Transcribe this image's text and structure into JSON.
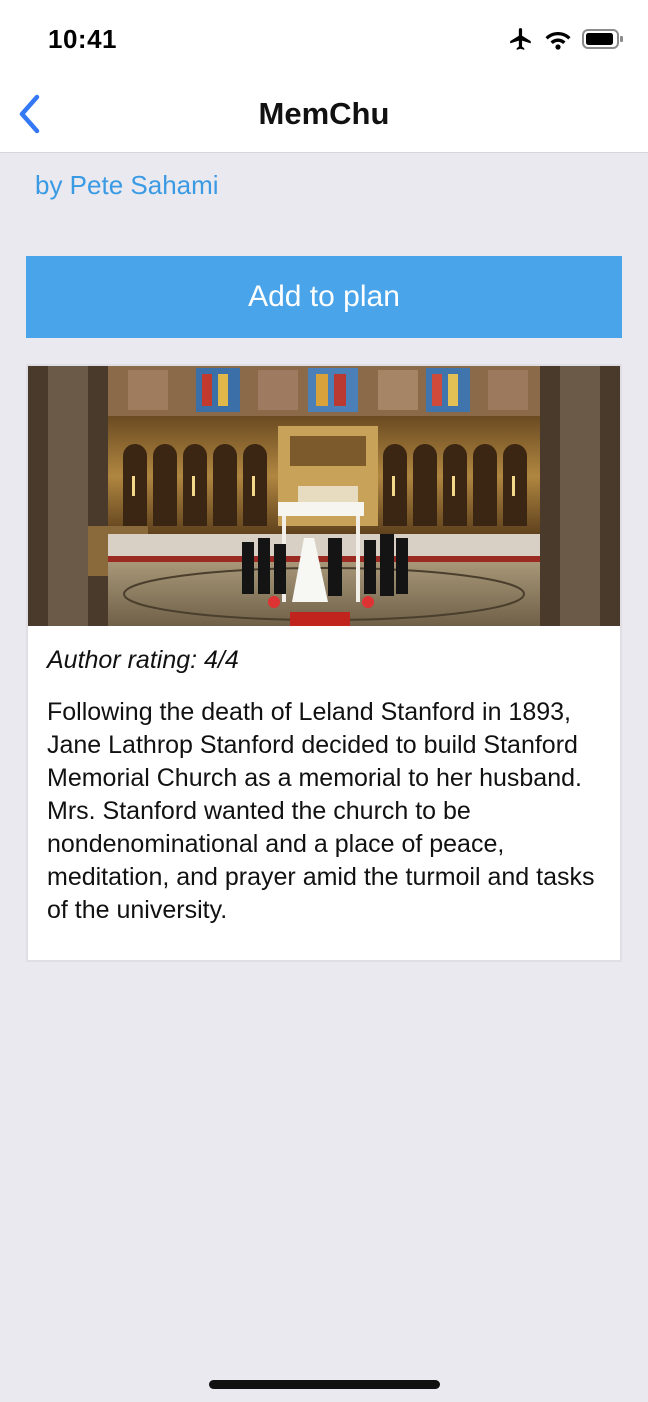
{
  "status_bar": {
    "time": "10:41",
    "icons": [
      "airplane-icon",
      "wifi-icon",
      "battery-icon"
    ]
  },
  "nav": {
    "title": "MemChu",
    "back_icon": "chevron-left-icon"
  },
  "detail": {
    "author": "by Pete Sahami",
    "add_button_label": "Add to plan",
    "rating": "Author rating: 4/4",
    "description": "Following the death of Leland Stanford in 1893, Jane Lathrop Stanford decided to build Stanford Memorial Church as a memorial to her husband. Mrs. Stanford wanted the church to be nondenominational and a place of peace, meditation, and prayer amid the turmoil and tasks of the university."
  },
  "colors": {
    "accent": "#4aa4ea",
    "link": "#3a9ae4",
    "background": "#e9e9ef"
  }
}
